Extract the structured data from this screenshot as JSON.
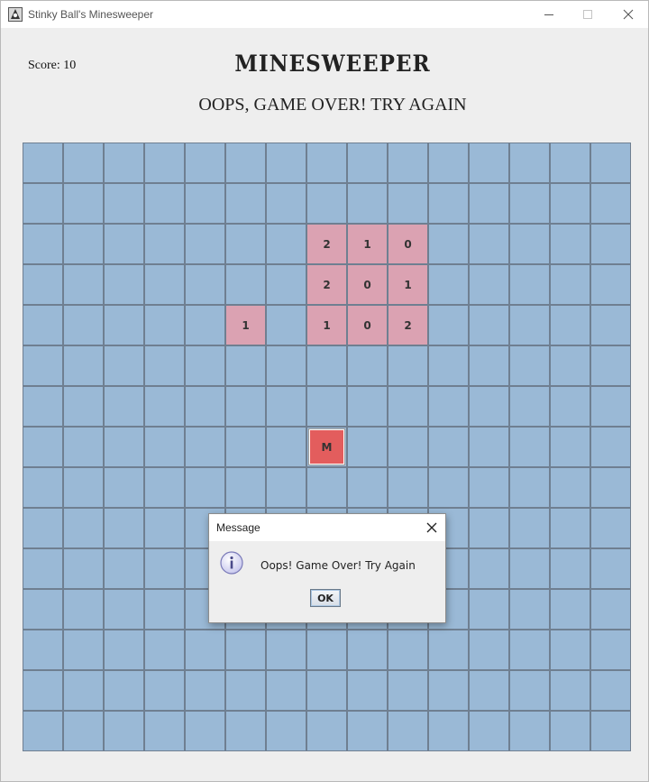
{
  "window": {
    "title": "Stinky Ball's Minesweeper"
  },
  "header": {
    "score_text": "Score: 10",
    "game_title": "MINESWEEPER",
    "status_text": "OOPS, GAME OVER! TRY AGAIN"
  },
  "board": {
    "rows": 15,
    "cols": 15,
    "revealed_cells": [
      {
        "row": 2,
        "col": 7,
        "value": "2"
      },
      {
        "row": 2,
        "col": 8,
        "value": "1"
      },
      {
        "row": 2,
        "col": 9,
        "value": "0"
      },
      {
        "row": 3,
        "col": 7,
        "value": "2"
      },
      {
        "row": 3,
        "col": 8,
        "value": "0"
      },
      {
        "row": 3,
        "col": 9,
        "value": "1"
      },
      {
        "row": 4,
        "col": 5,
        "value": "1"
      },
      {
        "row": 4,
        "col": 7,
        "value": "1"
      },
      {
        "row": 4,
        "col": 8,
        "value": "0"
      },
      {
        "row": 4,
        "col": 9,
        "value": "2"
      }
    ],
    "mine_cell": {
      "row": 7,
      "col": 7,
      "value": "M"
    },
    "colors": {
      "hidden": "#9ab9d6",
      "revealed": "#dba2b2",
      "mine": "#e35d5d",
      "grid_line": "#6f7f91"
    }
  },
  "dialog": {
    "title": "Message",
    "message": "Oops! Game Over! Try Again",
    "ok_label": "OK",
    "icon": "info-icon"
  },
  "icons": {
    "app": "minesweeper-app-icon",
    "minimize": "minimize-icon",
    "maximize": "maximize-icon",
    "close": "close-icon"
  }
}
